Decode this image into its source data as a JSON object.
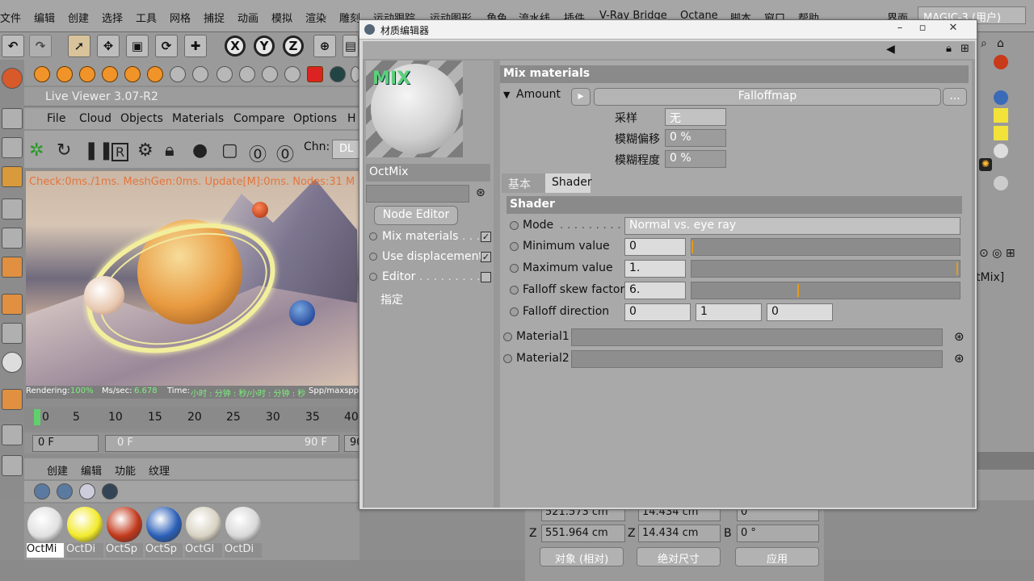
{
  "menubar": {
    "items": [
      "文件",
      "编辑",
      "创建",
      "选择",
      "工具",
      "网格",
      "捕捉",
      "动画",
      "模拟",
      "渲染",
      "雕刻",
      "运动跟踪",
      "运动图形",
      "角色",
      "流水线",
      "插件",
      "V-Ray Bridge",
      "Octane",
      "脚本",
      "窗口",
      "帮助"
    ],
    "layout_label": "界面",
    "layout_value": "MAGIC-3 (用户)"
  },
  "toolbar": {
    "axis_x": "X",
    "axis_y": "Y",
    "axis_z": "Z"
  },
  "live_viewer": {
    "title": "Live Viewer 3.07-R2",
    "menu": [
      "File",
      "Cloud",
      "Objects",
      "Materials",
      "Compare",
      "Options",
      "H"
    ],
    "chn_label": "Chn:",
    "chn_value": "DL",
    "stats_overlay": "Check:0ms./1ms. MeshGen:0ms. Update[M]:0ms. Nodes:31 M",
    "status": {
      "rendering_label": "Rendering:",
      "rendering_value": "100%",
      "mssec_label": "Ms/sec:",
      "mssec_value": "6.678",
      "time_label": "Time:",
      "time_value": "小时 : 分钟 : 秒/小时 : 分钟 : 秒",
      "spp_label": "Spp/maxspp:"
    }
  },
  "timeline": {
    "ticks": [
      "0",
      "5",
      "10",
      "15",
      "20",
      "25",
      "30",
      "35",
      "40"
    ]
  },
  "framebar": {
    "start": "0 F",
    "range_start": "0 F",
    "range_end": "90 F",
    "end": "90"
  },
  "material_manager": {
    "menu": [
      "创建",
      "编辑",
      "功能",
      "纹理"
    ],
    "materials": [
      {
        "name": "OctMi",
        "color": "#e0e0e0",
        "selected": true
      },
      {
        "name": "OctDi",
        "color": "#f2ea2a",
        "selected": false
      },
      {
        "name": "OctSp",
        "color": "#c2381a",
        "selected": false
      },
      {
        "name": "OctSp",
        "color": "#2a5fb8",
        "selected": false
      },
      {
        "name": "OctGl",
        "color": "#d7d2c2",
        "selected": false
      },
      {
        "name": "OctDi",
        "color": "#d8d8d8",
        "selected": false
      }
    ]
  },
  "coordinates": {
    "row0": {
      "a": "521.573 cm",
      "b": "14.434 cm",
      "c": "0 °"
    },
    "row1": {
      "z_label": "Z",
      "z_pos": "551.964 cm",
      "z2_label": "Z",
      "z_size": "14.434 cm",
      "b_label": "B",
      "b_value": "0 °"
    },
    "mode1": "对象 (相对)",
    "mode2": "绝对尺寸",
    "apply": "应用"
  },
  "right_panel": {
    "mix_label": "tMix]"
  },
  "dialog": {
    "title": "材质编辑器",
    "preview_badge": "MIX",
    "material_name": "OctMix",
    "node_editor": "Node Editor",
    "channels": [
      {
        "label": "Mix materials",
        "checked": true
      },
      {
        "label": "Use displacement",
        "checked": true
      },
      {
        "label": "Editor",
        "checked": false
      }
    ],
    "assign": "指定",
    "section_title": "Mix materials",
    "amount_label": "Amount",
    "amount_shader": "Falloffmap",
    "ellipsis": "...",
    "sampling_label": "采样",
    "sampling_value": "无",
    "blur_offset_label": "模糊偏移",
    "blur_offset_value": "0 %",
    "blur_degree_label": "模糊程度",
    "blur_degree_value": "0 %",
    "tabs": [
      "基本",
      "Shader"
    ],
    "shader_title": "Shader",
    "mode_label": "Mode",
    "mode_value": "Normal vs. eye ray",
    "min_label": "Minimum value",
    "min_value": "0",
    "min_fraction": 0.0,
    "max_label": "Maximum value",
    "max_value": "1.",
    "max_fraction": 1.0,
    "skew_label": "Falloff skew factor",
    "skew_value": "6.",
    "skew_fraction": 0.4,
    "dir_label": "Falloff direction",
    "dir_values": [
      "0",
      "1",
      "0"
    ],
    "material1_label": "Material1",
    "material2_label": "Material2"
  }
}
